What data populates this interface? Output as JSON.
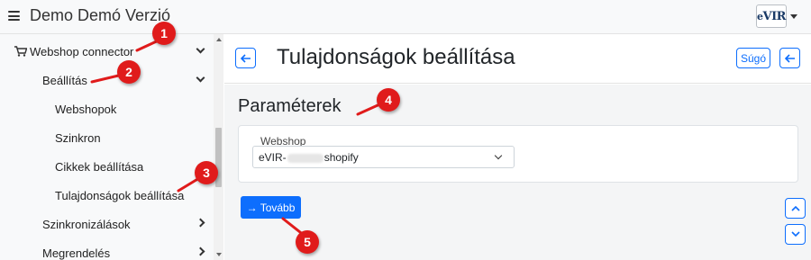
{
  "app": {
    "title": "Demo Demó Verzió",
    "logo_text_prefix": "e",
    "logo_text": "VIR"
  },
  "sidebar": {
    "items": [
      {
        "label": "Webshop connector",
        "chevron": "down"
      },
      {
        "label": "Beállítás",
        "chevron": "down"
      },
      {
        "label": "Webshopok"
      },
      {
        "label": "Szinkron"
      },
      {
        "label": "Cikkek beállítása"
      },
      {
        "label": "Tulajdonságok beállítása"
      },
      {
        "label": "Szinkronizálások",
        "chevron": "right"
      },
      {
        "label": "Megrendelés",
        "chevron": "right"
      }
    ]
  },
  "header": {
    "title": "Tulajdonságok beállítása",
    "back_icon": "arrow-left-icon",
    "help_label": "Súgó"
  },
  "content": {
    "section_title": "Paraméterek",
    "field_label": "Webshop",
    "select_value_prefix": "eVIR-",
    "select_value_suffix": "shopify",
    "next_label": "→ Tovább"
  },
  "markers": [
    "1",
    "2",
    "3",
    "4",
    "5"
  ],
  "colors": {
    "accent": "#0d6efd",
    "marker": "#e01b1b",
    "sidebar_bg": "#f8f9fa",
    "content_bg": "#f4f5f6"
  }
}
